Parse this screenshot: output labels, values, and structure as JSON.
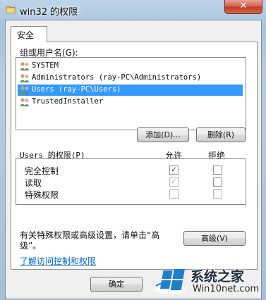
{
  "window": {
    "title": "win32 的权限",
    "close_label": "✕"
  },
  "tabs": [
    {
      "label": "安全"
    }
  ],
  "groups": {
    "label": "组或用户名(G):",
    "items": [
      {
        "name": "SYSTEM",
        "selected": false
      },
      {
        "name": "Administrators (ray-PC\\Administrators)",
        "selected": false
      },
      {
        "name": "Users (ray-PC\\Users)",
        "selected": true
      },
      {
        "name": "TrustedInstaller",
        "selected": false
      }
    ]
  },
  "buttons": {
    "add": "添加(D)...",
    "remove": "删除(R)",
    "advanced": "高级(V)",
    "ok": "确定"
  },
  "permissions": {
    "label": "Users 的权限(P)",
    "allow_header": "允许",
    "deny_header": "拒绝",
    "rows": [
      {
        "name": "完全控制",
        "allow": "checked",
        "deny": "unchecked"
      },
      {
        "name": "读取",
        "allow": "checked-disabled",
        "deny": "unchecked"
      },
      {
        "name": "特殊权限",
        "allow": "disabled",
        "deny": "disabled"
      }
    ]
  },
  "advanced_hint": {
    "line1": "有关特殊权限或高级设置，请单击“高",
    "line2": "级”。"
  },
  "link_text": "了解访问控制和权限",
  "watermark": {
    "brand": "系统之家",
    "site": "Win10net.com"
  }
}
